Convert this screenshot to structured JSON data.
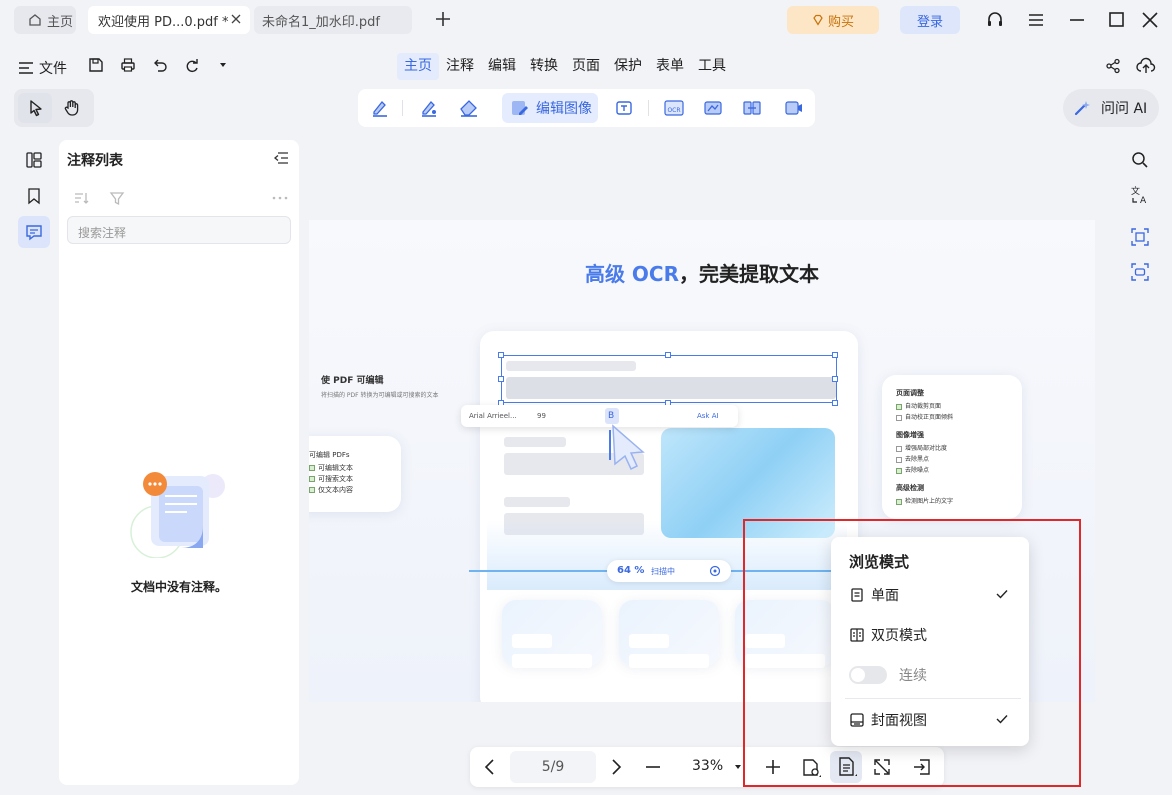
{
  "tabs": {
    "home": "主页",
    "active": "欢迎使用 PD...0.pdf *",
    "inactive": "未命名1_加水印.pdf"
  },
  "header": {
    "buy": "购买",
    "login": "登录"
  },
  "menu": {
    "file": "文件",
    "nav": [
      "主页",
      "注释",
      "编辑",
      "转换",
      "页面",
      "保护",
      "表单",
      "工具"
    ],
    "selected": "主页"
  },
  "toolbar": {
    "edit_image": "编辑图像",
    "ask_ai": "问问 AI"
  },
  "panel": {
    "title": "注释列表",
    "search_placeholder": "搜索注释",
    "empty_text": "文档中没有注释。"
  },
  "document": {
    "headline_hl": "高级 OCR",
    "headline_rest": "，完美提取文本",
    "left_title": "使 PDF 可编辑",
    "left_sub": "将扫描的 PDF 转换为可编辑或可搜索的文本",
    "left_card_title": "可编辑 PDFs",
    "left_card_items": [
      "可编辑文本",
      "可搜索文本",
      "仅文本内容"
    ],
    "right_card": {
      "sec1": "页面调整",
      "sec1_items": [
        "自动裁剪页面",
        "自动校正页面倾斜"
      ],
      "sec2": "图像增强",
      "sec2_items": [
        "增强局部对比度",
        "去除黑点",
        "去除噪点"
      ],
      "sec3": "高级检测",
      "sec3_items": [
        "检测图片上的文字"
      ]
    },
    "floatbar": {
      "font": "Arial Arrieel...",
      "size": "99",
      "ask": "Ask AI"
    },
    "scan_percent": "64 %",
    "scan_label": "扫描中"
  },
  "bottombar": {
    "page": "5/9",
    "zoom": "33%"
  },
  "popup": {
    "title": "浏览模式",
    "single": "单面",
    "double": "双页模式",
    "continuous": "连续",
    "cover": "封面视图"
  }
}
